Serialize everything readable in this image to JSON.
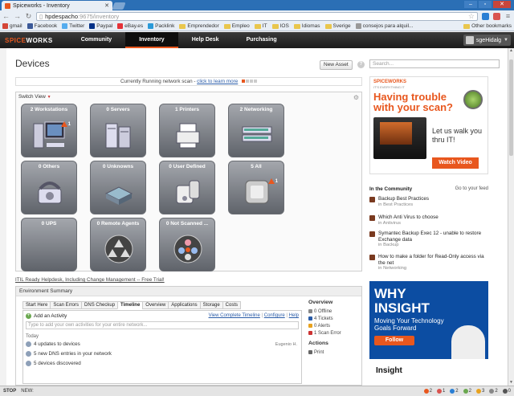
{
  "browser": {
    "tab_title": "Spiceworks - Inventory",
    "url_host": "hpdespacho",
    "url_path": ":9675/inventory",
    "bookmarks": [
      {
        "label": "gmail",
        "color": "#d44638"
      },
      {
        "label": "Facebook",
        "color": "#3b5998"
      },
      {
        "label": "Twitter",
        "color": "#55acee"
      },
      {
        "label": "Paypal",
        "color": "#003087"
      },
      {
        "label": "eBay.es",
        "color": "#e53238"
      },
      {
        "label": "Packlink",
        "color": "#2b9ad8"
      },
      {
        "label": "Emprendedor",
        "color": "folder"
      },
      {
        "label": "Empleo",
        "color": "folder"
      },
      {
        "label": "IT",
        "color": "folder"
      },
      {
        "label": "IOS",
        "color": "folder"
      },
      {
        "label": "Idiomas",
        "color": "folder"
      },
      {
        "label": "Sverige",
        "color": "folder"
      },
      {
        "label": "consejos para alquil...",
        "color": "#999999"
      }
    ],
    "other_bookmarks": "Other bookmarks"
  },
  "nav": {
    "logo_spice": "SPICE",
    "logo_works": "WORKS",
    "menu": [
      "Community",
      "Inventory",
      "Help Desk",
      "Purchasing"
    ],
    "active": "Inventory",
    "user": "sgeHidalg"
  },
  "page": {
    "title": "Devices",
    "new_asset": "New Asset",
    "search_placeholder": "Search..."
  },
  "scan": {
    "text": "Currently Running network scan - ",
    "link": "click to learn more"
  },
  "switch_view": "Switch View",
  "tiles": [
    {
      "label": "2 Workstations",
      "alert": "1",
      "icon": "workstation-icon"
    },
    {
      "label": "0 Servers",
      "alert": "",
      "icon": "server-icon"
    },
    {
      "label": "1 Printers",
      "alert": "",
      "icon": "printer-icon"
    },
    {
      "label": "2 Networking",
      "alert": "",
      "icon": "switch-icon"
    },
    {
      "label": "0 Others",
      "alert": "",
      "icon": "phone-icon"
    },
    {
      "label": "0 Unknowns",
      "alert": "",
      "icon": "unknown-device-icon"
    },
    {
      "label": "0 User Defined",
      "alert": "",
      "icon": "user-defined-icon"
    },
    {
      "label": "5 All",
      "alert": "1",
      "icon": "all-devices-icon"
    },
    {
      "label": "0 UPS",
      "alert": "",
      "icon": "ups-icon"
    },
    {
      "label": "0 Remote Agents",
      "alert": "",
      "icon": "remote-agent-icon"
    },
    {
      "label": "0 Not Scanned ...",
      "alert": "",
      "icon": "not-scanned-icon"
    }
  ],
  "itil_link": "ITIL Ready Helpdesk, Including Change Management -- Free Trial!",
  "env": {
    "title": "Environment Summary",
    "tabs": [
      "Start Here",
      "Scan Errors",
      "DNS Checkup",
      "Timeline",
      "Overview",
      "Applications",
      "Storage",
      "Costs"
    ],
    "active_tab": "Timeline",
    "add_activity": "Add an Activity",
    "view_timeline": "View Complete Timeline",
    "configure": "Configure",
    "help": "Help",
    "activity_placeholder": "Type to add your own activities for your entire network...",
    "today": "Today",
    "rows": [
      {
        "text": "4 updates to devices",
        "by": "Eugenio H."
      },
      {
        "text": "5 new DNS entries in your network",
        "by": ""
      },
      {
        "text": "5 devices discovered",
        "by": ""
      }
    ]
  },
  "overview": {
    "title": "Overview",
    "items": [
      {
        "label": "0 Offline",
        "color": "#888888"
      },
      {
        "label": "4 Tickets",
        "color": "#2a5ca8"
      },
      {
        "label": "0 Alerts",
        "color": "#e8a21e"
      },
      {
        "label": "1 Scan Error",
        "color": "#cc3333"
      }
    ],
    "actions_title": "Actions",
    "print": "Print"
  },
  "ad": {
    "logo": "SPICEWORKS",
    "tagline": "IT'S EVERYTHING IT",
    "headline": "Having trouble with your scan?",
    "walk": "Let us walk you thru IT!",
    "cta": "Watch Video"
  },
  "community": {
    "title": "In the Community",
    "link": "Go to your feed",
    "items": [
      {
        "title": "Backup Best Practices",
        "sub": "in Best Practices"
      },
      {
        "title": "Which Anti Virus to choose",
        "sub": "in Antivirus"
      },
      {
        "title": "Symantec Backup Exec 12 - unable to restore Exchange data",
        "sub": "in Backup"
      },
      {
        "title": "How to make a folder for Read-Only access via the net",
        "sub": "in Networking"
      }
    ]
  },
  "ad2": {
    "line1": "WHY",
    "line2": "INSIGHT",
    "sub": "Moving Your Technology Goals Forward",
    "cta": "Follow",
    "brand": "Insight"
  },
  "status": {
    "stop": "STOP",
    "new": "NEW:",
    "counts": [
      "2",
      "1",
      "2",
      "2",
      "3",
      "2",
      "0"
    ]
  }
}
